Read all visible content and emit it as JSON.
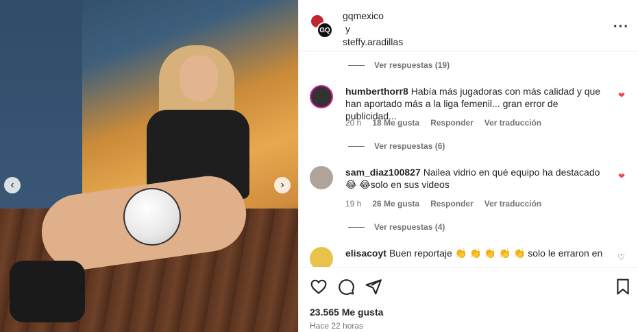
{
  "post": {
    "owner": "gqmexico",
    "connector": "y",
    "collaborator": "steffy.aradillas",
    "more_icon": "more-horizontal-icon",
    "avatar_label": "GQ"
  },
  "comments": [
    {
      "type": "replies",
      "label": "Ver respuestas (19)"
    },
    {
      "type": "comment",
      "user": "humberthorr8",
      "text": "Había más jugadoras con más calidad y que han aportado más a la liga femenil... gran error de publicidad...",
      "time": "20 h",
      "likes": "18 Me gusta",
      "reply": "Responder",
      "translate": "Ver traducción",
      "liked": true
    },
    {
      "type": "replies",
      "label": "Ver respuestas (6)"
    },
    {
      "type": "comment",
      "user": "sam_diaz100827",
      "text": "Nailea vidrio en qué equipo ha destacado 😂 😂solo en sus videos",
      "time": "19 h",
      "likes": "26 Me gusta",
      "reply": "Responder",
      "translate": "Ver traducción",
      "liked": true
    },
    {
      "type": "replies",
      "label": "Ver respuestas (4)"
    },
    {
      "type": "comment",
      "user": "elisacoyt",
      "text": "Buen reportaje 👏 👏 👏 👏 👏 solo le erraron en",
      "liked": false
    }
  ],
  "footer": {
    "likes": "23.565 Me gusta",
    "time": "Hace 22 horas"
  },
  "colors": {
    "like_red": "#ed4956",
    "muted": "#737373",
    "story_ring": "#d6249f"
  }
}
